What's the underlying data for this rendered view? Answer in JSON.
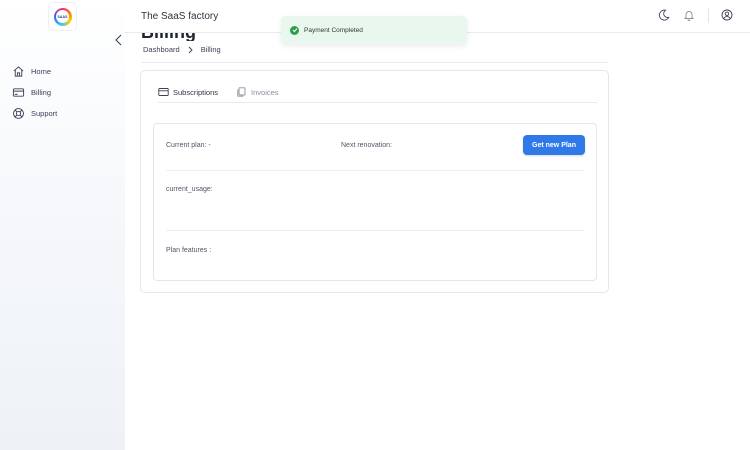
{
  "app": {
    "title": "The SaaS factory",
    "logo_text": "SAAS"
  },
  "sidebar": {
    "items": [
      {
        "label": "Home",
        "icon": "home-icon"
      },
      {
        "label": "Billing",
        "icon": "credit-card-icon"
      },
      {
        "label": "Support",
        "icon": "lifebuoy-icon"
      }
    ]
  },
  "header": {
    "icons": [
      "moon-icon",
      "bell-icon",
      "user-circle-icon"
    ]
  },
  "page": {
    "title": "Billing"
  },
  "breadcrumb": {
    "items": [
      "Dashboard",
      "Billing"
    ]
  },
  "toast": {
    "message": "Payment Completed",
    "status": "success",
    "color": "#2e9e4f"
  },
  "tabs": [
    {
      "label": "Subscriptions",
      "active": true,
      "icon": "credit-card-icon"
    },
    {
      "label": "Invoices",
      "active": false,
      "icon": "documents-icon"
    }
  ],
  "billing": {
    "current_plan_label": "Current plan: -",
    "next_renovation_label": "Next renovation:",
    "get_plan_button": "Get new Plan",
    "current_usage_label": "current_usage:",
    "plan_features_label": "Plan features :"
  },
  "colors": {
    "accent": "#2f7ae8",
    "toast_bg": "#eaf7ee"
  }
}
